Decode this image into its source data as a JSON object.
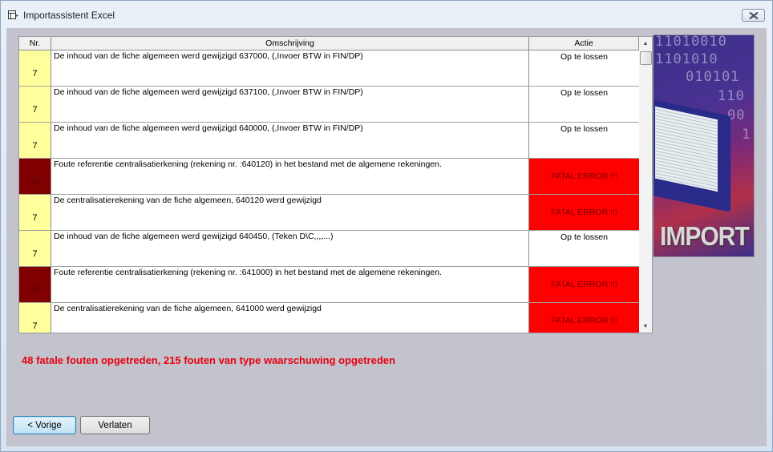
{
  "window": {
    "title": "Importassistent Excel",
    "icon": "wizard-window-icon",
    "close_icon": "close-icon"
  },
  "grid": {
    "columns": [
      "Nr.",
      "Omschrijving",
      "Actie"
    ],
    "rows": [
      {
        "nr": "7",
        "severity": "warning",
        "description": "De inhoud van de fiche algemeen werd gewijzigd 637000,  (,Invoer BTW in FIN/DP)",
        "action": "Op te lossen"
      },
      {
        "nr": "7",
        "severity": "warning",
        "description": "De inhoud van de fiche algemeen werd gewijzigd 637100,  (,Invoer BTW in FIN/DP)",
        "action": "Op te lossen"
      },
      {
        "nr": "7",
        "severity": "warning",
        "description": "De inhoud van de fiche algemeen werd gewijzigd 640000,  (,Invoer BTW in FIN/DP)",
        "action": "Op te lossen"
      },
      {
        "nr": "26",
        "severity": "fatal",
        "description": "Foute referentie centralisatierkening (rekening nr. :640120) in het bestand met de algemene rekeningen.",
        "action": "FATAL ERROR !!!"
      },
      {
        "nr": "7",
        "severity": "warning",
        "description": "De centralisatierekening van de fiche algemeen, 640120 werd gewijzigd",
        "action": "FATAL ERROR !!!"
      },
      {
        "nr": "7",
        "severity": "warning",
        "description": "De inhoud van de fiche algemeen werd gewijzigd 640450,  (Teken D\\C,,,,...)",
        "action": "Op te lossen"
      },
      {
        "nr": "26",
        "severity": "fatal",
        "description": "Foute referentie centralisatierkening (rekening nr. :641000) in het bestand met de algemene rekeningen.",
        "action": "FATAL ERROR !!!"
      },
      {
        "nr": "7",
        "severity": "warning",
        "description": "De centralisatierekening van de fiche algemeen, 641000 werd gewijzigd",
        "action": "FATAL ERROR !!!"
      }
    ],
    "scroll_up_icon": "scroll-up-arrow-icon",
    "scroll_down_icon": "scroll-down-arrow-icon"
  },
  "colors": {
    "warning_nr_bg": "#ffff9c",
    "fatal_nr_bg": "#800000",
    "fatal_action_bg": "#ff0000",
    "summary_text": "#e8000f"
  },
  "side_image": {
    "binary_lines": [
      "11010010",
      "1101010",
      "010101",
      "110",
      "00",
      "1"
    ],
    "caption": "IMPORT"
  },
  "summary": "48 fatale fouten opgetreden, 215 fouten van type waarschuwing opgetreden",
  "buttons": {
    "previous": "< Vorige",
    "exit": "Verlaten"
  }
}
